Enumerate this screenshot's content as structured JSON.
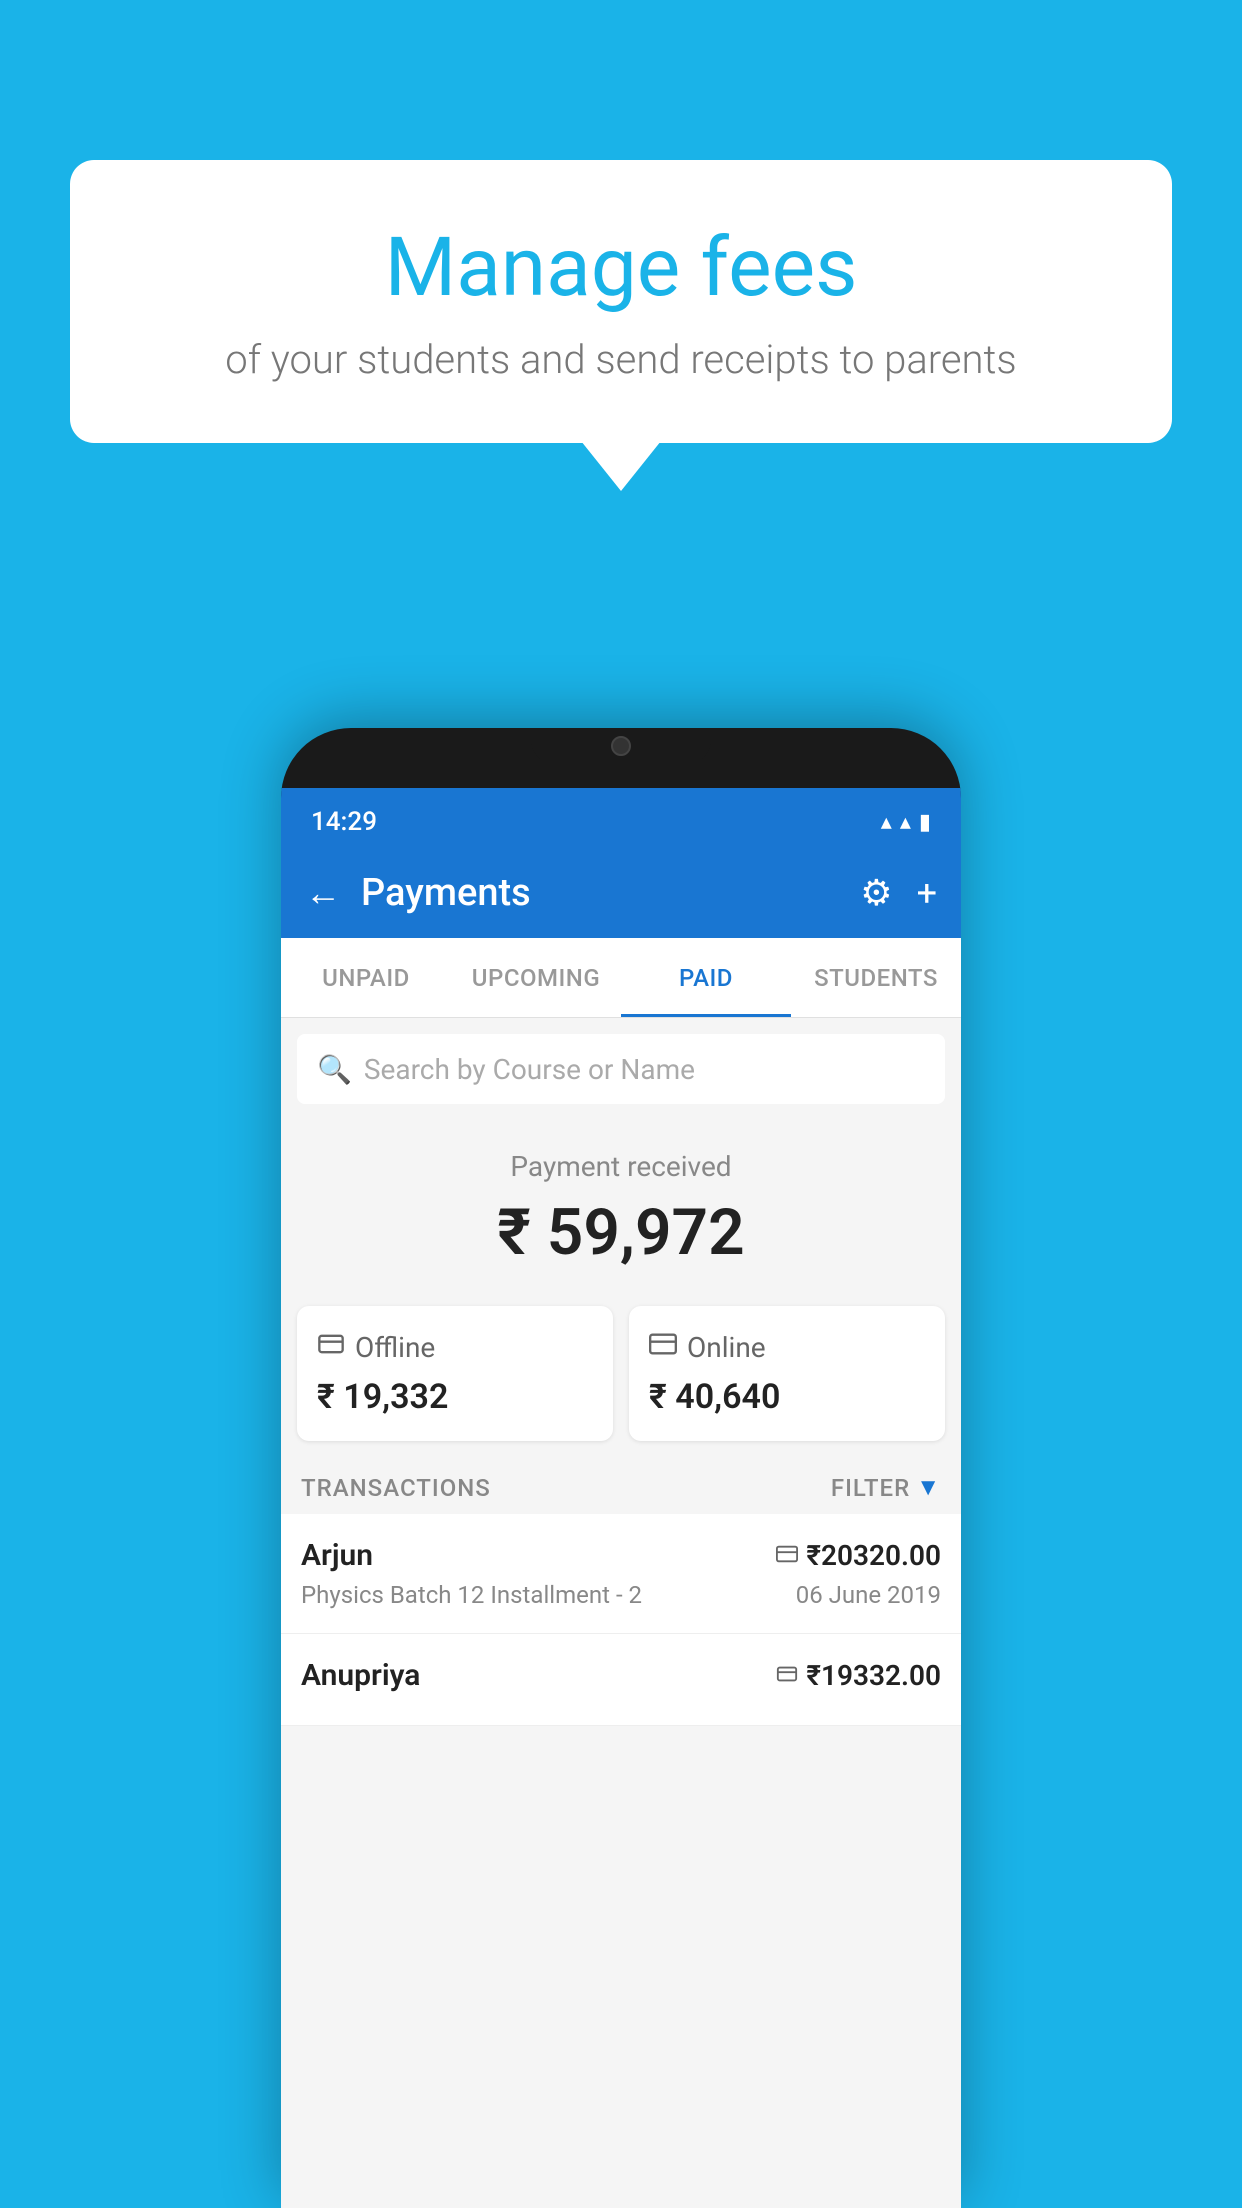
{
  "background_color": "#1ab3e8",
  "bubble": {
    "title": "Manage fees",
    "subtitle": "of your students and send receipts to parents"
  },
  "status_bar": {
    "time": "14:29",
    "wifi": "▼",
    "signal": "▲",
    "battery": "▮"
  },
  "app_bar": {
    "back_icon": "←",
    "title": "Payments",
    "gear_icon": "⚙",
    "plus_icon": "+"
  },
  "tabs": [
    {
      "label": "UNPAID",
      "active": false
    },
    {
      "label": "UPCOMING",
      "active": false
    },
    {
      "label": "PAID",
      "active": true
    },
    {
      "label": "STUDENTS",
      "active": false
    }
  ],
  "search": {
    "placeholder": "Search by Course or Name",
    "icon": "🔍"
  },
  "payment_received": {
    "label": "Payment received",
    "amount": "₹ 59,972"
  },
  "payment_cards": [
    {
      "icon": "💳",
      "label": "Offline",
      "amount": "₹ 19,332"
    },
    {
      "icon": "💳",
      "label": "Online",
      "amount": "₹ 40,640"
    }
  ],
  "transactions_header": {
    "label": "TRANSACTIONS",
    "filter_label": "FILTER",
    "filter_icon": "▼"
  },
  "transactions": [
    {
      "name": "Arjun",
      "type_icon": "💳",
      "amount": "₹20320.00",
      "course": "Physics Batch 12 Installment - 2",
      "date": "06 June 2019"
    },
    {
      "name": "Anupriya",
      "type_icon": "💴",
      "amount": "₹19332.00",
      "course": "",
      "date": ""
    }
  ]
}
